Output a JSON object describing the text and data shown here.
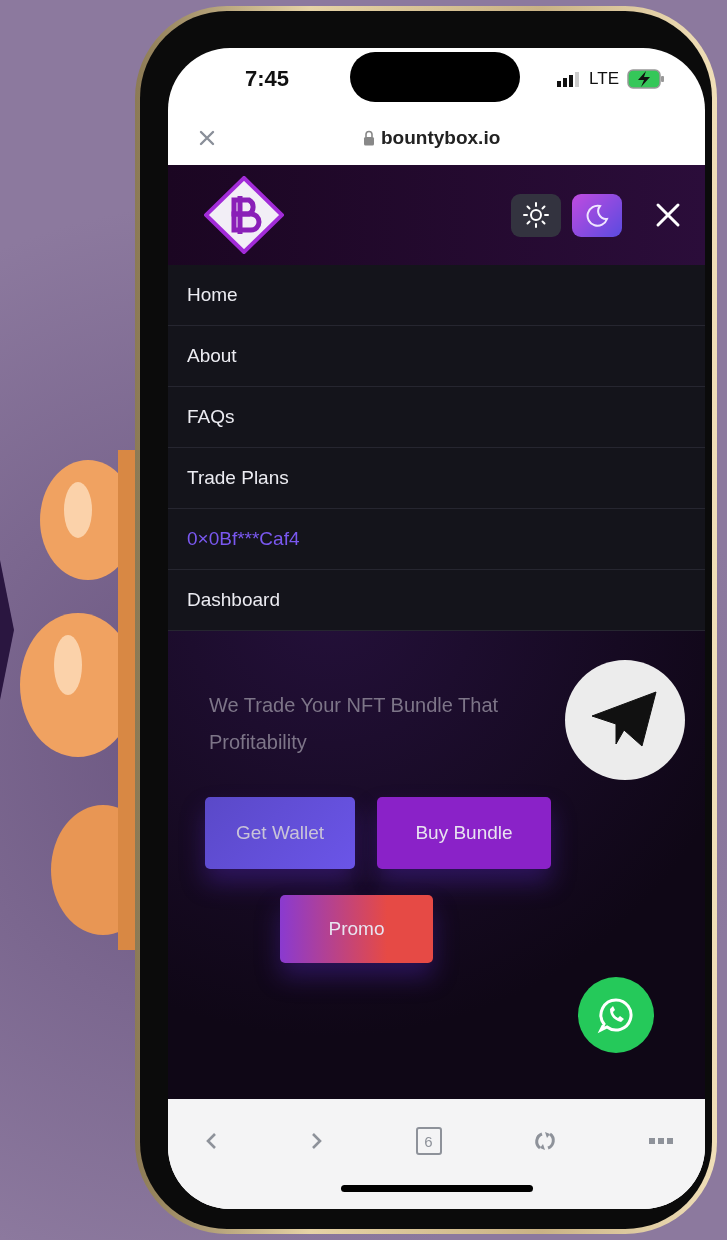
{
  "status_bar": {
    "time": "7:45",
    "network": "LTE",
    "charging": true
  },
  "browser": {
    "url": "bountybox.io",
    "secure": true
  },
  "header": {
    "theme_buttons": [
      {
        "kind": "light",
        "selected": false
      },
      {
        "kind": "dark",
        "selected": true
      }
    ]
  },
  "menu": {
    "items": [
      {
        "label": "Home",
        "kind": "link"
      },
      {
        "label": "About",
        "kind": "link"
      },
      {
        "label": "FAQs",
        "kind": "link"
      },
      {
        "label": "Trade Plans",
        "kind": "link"
      },
      {
        "label": "0×0Bf***Caf4",
        "kind": "wallet"
      },
      {
        "label": "Dashboard",
        "kind": "link"
      }
    ]
  },
  "hero": {
    "subtitle_lines": [
      "We Trade Your NFT Bundle That",
      "Profitability"
    ],
    "buttons": [
      {
        "label": "Get Wallet",
        "kind": "wallet"
      },
      {
        "label": "Buy Bundle",
        "kind": "buy"
      },
      {
        "label": "Promo",
        "kind": "promo"
      }
    ]
  },
  "toolbar": {
    "tab_count": "6"
  }
}
